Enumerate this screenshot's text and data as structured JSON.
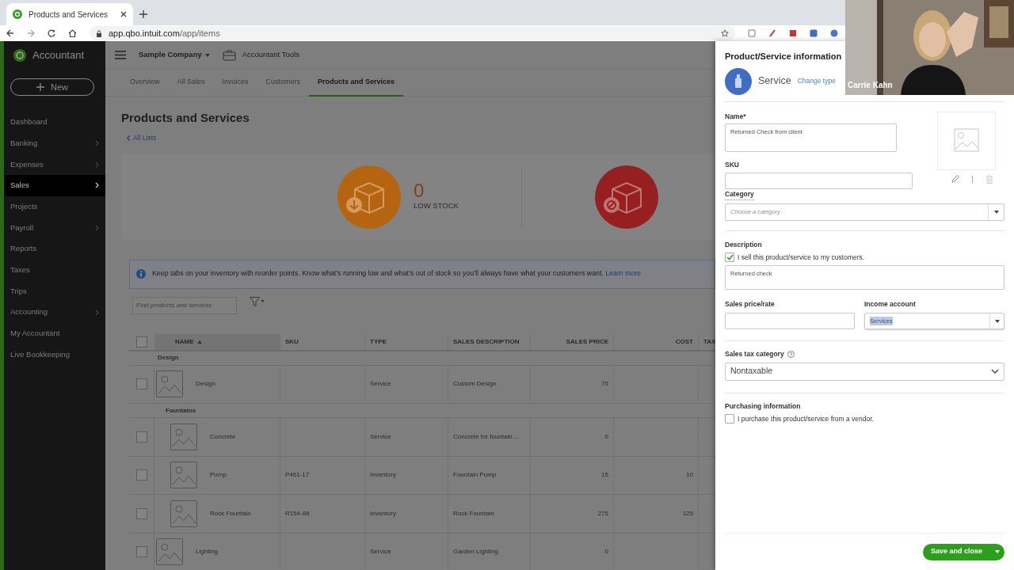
{
  "browser": {
    "tab_title": "Products and Services",
    "url_host": "app.qbo.intuit.com",
    "url_path": "/app/items"
  },
  "sidebar": {
    "brand": "Accountant",
    "new_button": "New",
    "items": [
      {
        "label": "Dashboard",
        "selected": false,
        "submenu": false
      },
      {
        "label": "Banking",
        "selected": false,
        "submenu": true
      },
      {
        "label": "Expenses",
        "selected": false,
        "submenu": true
      },
      {
        "label": "Sales",
        "selected": true,
        "submenu": true
      },
      {
        "label": "Projects",
        "selected": false,
        "submenu": false
      },
      {
        "label": "Payroll",
        "selected": false,
        "submenu": true
      },
      {
        "label": "Reports",
        "selected": false,
        "submenu": false
      },
      {
        "label": "Taxes",
        "selected": false,
        "submenu": false
      },
      {
        "label": "Trips",
        "selected": false,
        "submenu": false
      },
      {
        "label": "Accounting",
        "selected": false,
        "submenu": true
      },
      {
        "label": "My Accountant",
        "selected": false,
        "submenu": false
      },
      {
        "label": "Live Bookkeeping",
        "selected": false,
        "submenu": false
      }
    ]
  },
  "header": {
    "company": "Sample Company",
    "tools": "Accountant Tools"
  },
  "subtabs": [
    {
      "label": "Overview",
      "selected": false
    },
    {
      "label": "All Sales",
      "selected": false
    },
    {
      "label": "Invoices",
      "selected": false
    },
    {
      "label": "Customers",
      "selected": false
    },
    {
      "label": "Products and Services",
      "selected": true
    }
  ],
  "page": {
    "title": "Products and Services",
    "back_link": "All Lists",
    "stock_cards": [
      {
        "kind": "low_stock",
        "count": "0",
        "label": "LOW STOCK"
      },
      {
        "kind": "out_of_stock"
      }
    ],
    "banner": {
      "text": "Keep tabs on your inventory with reorder points. Know what’s running low and what’s out of stock so you’ll always have what your customers want.",
      "link": "Learn more"
    },
    "search": {
      "placeholder": "Find products and services"
    },
    "table": {
      "header_checked": false,
      "columns": [
        {
          "label": "NAME",
          "sorted": true
        },
        {
          "label": "SKU",
          "sorted": false
        },
        {
          "label": "TYPE",
          "sorted": false
        },
        {
          "label": "SALES DESCRIPTION",
          "sorted": false
        },
        {
          "label": "SALES PRICE",
          "sorted": false
        },
        {
          "label": "COST",
          "sorted": false
        },
        {
          "label": "TAX"
        }
      ],
      "rows": [
        {
          "kind": "category",
          "label": "Design"
        },
        {
          "kind": "item",
          "checked": false,
          "name": "Design",
          "type": "Service",
          "description": "Custom Design",
          "price": "75"
        },
        {
          "kind": "category",
          "label": "Fountains",
          "children": [
            {
              "kind": "item",
              "checked": false,
              "name": "Concrete",
              "type": "Service",
              "description": "Concrete for fountain ...",
              "price": "0"
            },
            {
              "kind": "item",
              "checked": false,
              "name": "Pump",
              "sku": "P461-17",
              "type": "Inventory",
              "description": "Fountain Pump",
              "price": "15",
              "cost": "10"
            },
            {
              "kind": "item",
              "checked": false,
              "name": "Rock Fountain",
              "sku": "R154-88",
              "type": "Inventory",
              "description": "Rock Fountain",
              "price": "275",
              "cost": "125"
            }
          ]
        },
        {
          "kind": "item",
          "checked": false,
          "name": "Lighting",
          "type": "Service",
          "description": "Garden Lighting",
          "price": "0"
        }
      ]
    }
  },
  "drawer": {
    "title": "Product/Service information",
    "type": "Service",
    "change_type": "Change type",
    "name_label": "Name*",
    "name_value": "Returned Check from client",
    "sku_label": "SKU",
    "category_label": "Category",
    "category_placeholder": "Choose a category",
    "description_label": "Description",
    "sell": {
      "label": "I sell this product/service to my customers.",
      "checked": true
    },
    "description_value": "Returned check",
    "price_label": "Sales price/rate",
    "income_label": "Income account",
    "income_value": "Services",
    "income_highlighted": true,
    "tax_label": "Sales tax category",
    "tax_value": "Nontaxable",
    "purchasing_label": "Purchasing information",
    "purchase": {
      "label": "I purchase this product/service from a vendor.",
      "checked": false
    },
    "save_button": "Save and close"
  },
  "video": {
    "name": "Carrie Kahn"
  }
}
